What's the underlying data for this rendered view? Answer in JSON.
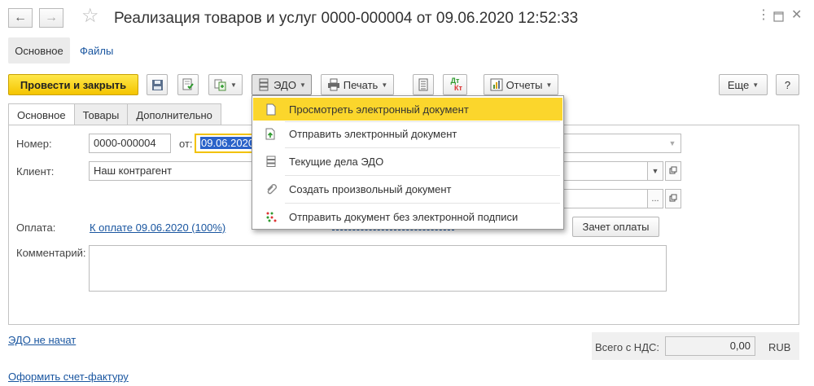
{
  "header": {
    "title": "Реализация товаров и услуг 0000-000004 от 09.06.2020 12:52:33",
    "back_icon": "arrow-left-icon",
    "forward_icon": "arrow-right-icon",
    "favorite_icon": "star-icon",
    "more_icon": "kebab-icon",
    "maximize_icon": "maximize-icon",
    "close_icon": "close-icon"
  },
  "top_nav": {
    "main_tab": "Основное",
    "files_link": "Файлы"
  },
  "toolbar": {
    "post_and_close": "Провести и закрыть",
    "edo": "ЭДО",
    "print": "Печать",
    "reports": "Отчеты",
    "more": "Еще",
    "help": "?",
    "dtkt_top": "Дт",
    "dtkt_bottom": "Кт"
  },
  "tabs": [
    "Основное",
    "Товары",
    "Дополнительно"
  ],
  "form": {
    "number_label": "Номер:",
    "number_value": "0000-000004",
    "date_label": "от:",
    "date_value": "09.06.2020",
    "client_label": "Клиент:",
    "client_value": "Наш контрагент",
    "payment_label": "Оплата:",
    "payment_link": "К оплате 09.06.2020 (100%)",
    "offset_button": "Зачет оплаты",
    "comment_label": "Комментарий:",
    "comment_value": ""
  },
  "edo_menu": {
    "items": [
      {
        "label": "Просмотреть электронный документ",
        "icon": "document-icon",
        "highlighted": true
      },
      {
        "label": "Отправить электронный документ",
        "icon": "send-document-icon",
        "highlighted": false
      },
      {
        "label": "Текущие дела ЭДО",
        "icon": "tasks-icon",
        "highlighted": false
      },
      {
        "label": "Создать произвольный документ",
        "icon": "paperclip-icon",
        "highlighted": false
      },
      {
        "label": "Отправить документ без электронной подписи",
        "icon": "send-unsigned-icon",
        "highlighted": false
      }
    ]
  },
  "footer": {
    "edo_status_link": "ЭДО не начат",
    "invoice_link": "Оформить счет-фактуру",
    "total_label": "Всего с НДС:",
    "total_value": "0,00",
    "currency": "RUB"
  },
  "colors": {
    "accent_yellow": "#f4c400",
    "menu_highlight": "#fbd62c",
    "link_blue": "#1a56a0",
    "selection_blue": "#2a62c9"
  }
}
